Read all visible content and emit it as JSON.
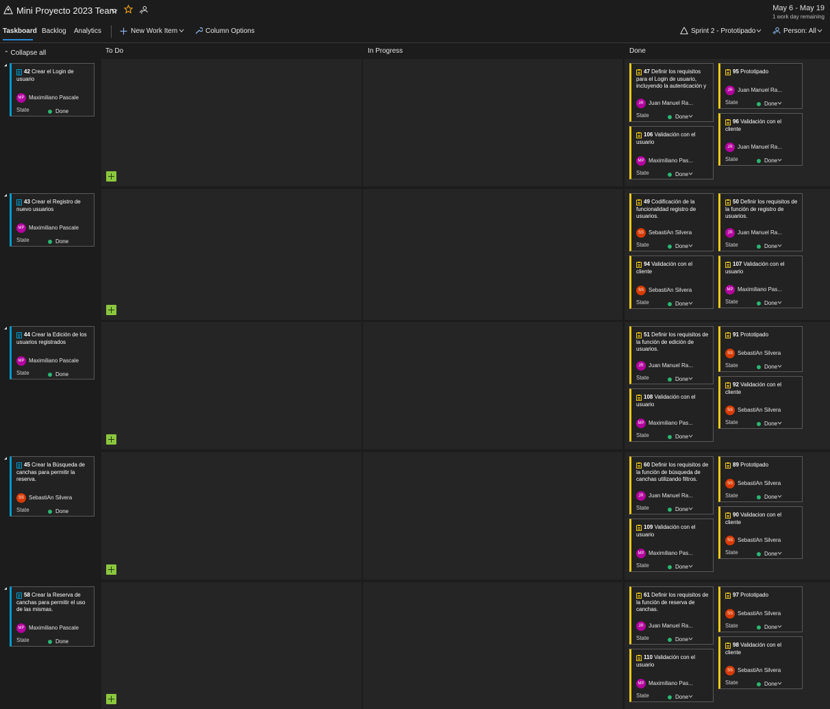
{
  "header": {
    "team_title": "Mini Proyecto 2023 Team",
    "date_range": "May 6 - May 19",
    "work_days": "1 work day remaining"
  },
  "nav": {
    "tabs": [
      {
        "label": "Taskboard",
        "active": true
      },
      {
        "label": "Backlog",
        "active": false
      },
      {
        "label": "Analytics",
        "active": false
      }
    ],
    "new_work_item": "New Work Item",
    "column_options": "Column Options",
    "sprint": "Sprint 2 - Prototipado",
    "person_filter": "Person: All"
  },
  "board": {
    "collapse_all": "Collapse all",
    "columns": [
      "To Do",
      "In Progress",
      "Done"
    ],
    "state_label": "State",
    "lanes": [
      {
        "story": {
          "id": "42",
          "title": "Crear el Login de usuario",
          "assignee": "Maximiliano Pascale",
          "initials": "MP",
          "state": "Done"
        },
        "tasks": [
          {
            "id": "47",
            "title": "Definir los requisitos para el Login de usuario, incluyendo la autenticación y",
            "assignee": "Juan Manuel Ra...",
            "initials": "JR",
            "state": "Done"
          },
          {
            "id": "95",
            "title": "Prototipado",
            "assignee": "Juan Manuel Ra...",
            "initials": "JR",
            "state": "Done"
          },
          {
            "id": "106",
            "title": "Validación con el usuario",
            "assignee": "Maximiliano Pas...",
            "initials": "MP",
            "state": "Done"
          },
          {
            "id": "96",
            "title": "Validación con el cliente",
            "assignee": "Juan Manuel Ra...",
            "initials": "JR",
            "state": "Done"
          }
        ]
      },
      {
        "story": {
          "id": "43",
          "title": "Crear el Registro de nuevo usuarios",
          "assignee": "Maximiliano Pascale",
          "initials": "MP",
          "state": "Done"
        },
        "tasks": [
          {
            "id": "49",
            "title": "Codificación de la funcionalidad registro de usuarios.",
            "assignee": "SebastiAn Silvera",
            "initials": "SS",
            "state": "Done"
          },
          {
            "id": "50",
            "title": "Definir los requisitos de la función de registro de usuarios.",
            "assignee": "Juan Manuel Ra...",
            "initials": "JR",
            "state": "Done"
          },
          {
            "id": "94",
            "title": "Validación con el cliente",
            "assignee": "SebastiAn Silvera",
            "initials": "SS",
            "state": "Done"
          },
          {
            "id": "107",
            "title": "Validación con el usuario",
            "assignee": "Maximiliano Pas...",
            "initials": "MP",
            "state": "Done"
          }
        ]
      },
      {
        "story": {
          "id": "44",
          "title": "Crear la Edición de los usuarios registrados",
          "assignee": "Maximiliano Pascale",
          "initials": "MP",
          "state": "Done"
        },
        "tasks": [
          {
            "id": "51",
            "title": "Definir los requisitos de la función de edición de usuarios.",
            "assignee": "Juan Manuel Ra...",
            "initials": "JR",
            "state": "Done"
          },
          {
            "id": "91",
            "title": "Prototipado",
            "assignee": "SebastiAn Silvera",
            "initials": "SS",
            "state": "Done"
          },
          {
            "id": "108",
            "title": "Validación con el usuario",
            "assignee": "Maximiliano Pas...",
            "initials": "MP",
            "state": "Done"
          },
          {
            "id": "92",
            "title": "Validación con el cliente",
            "assignee": "SebastiAn Silvera",
            "initials": "SS",
            "state": "Done"
          }
        ]
      },
      {
        "story": {
          "id": "45",
          "title": "Crear la Búsqueda de canchas para permitir la reserva.",
          "assignee": "SebastiAn Silvera",
          "initials": "SS",
          "state": "Done"
        },
        "tasks": [
          {
            "id": "60",
            "title": "Definir los requisitos de la función de búsqueda de canchas utilizando filtros.",
            "assignee": "Juan Manuel Ra...",
            "initials": "JR",
            "state": "Done"
          },
          {
            "id": "89",
            "title": "Prototipado",
            "assignee": "SebastiAn Silvera",
            "initials": "SS",
            "state": "Done"
          },
          {
            "id": "109",
            "title": "Validación con el usuario",
            "assignee": "Maximiliano Pas...",
            "initials": "MP",
            "state": "Done"
          },
          {
            "id": "90",
            "title": "Validacion con el cliente",
            "assignee": "SebastiAn Silvera",
            "initials": "SS",
            "state": "Done"
          }
        ]
      },
      {
        "story": {
          "id": "58",
          "title": "Crear la Reserva de canchas para permitir el uso de las mismas.",
          "assignee": "Maximiliano Pascale",
          "initials": "MP",
          "state": "Done"
        },
        "tasks": [
          {
            "id": "61",
            "title": "Definir los requisitos de la función de reserva de canchas.",
            "assignee": "Juan Manuel Ra...",
            "initials": "JR",
            "state": "Done"
          },
          {
            "id": "97",
            "title": "Prototipado",
            "assignee": "SebastiAn Silvera",
            "initials": "SS",
            "state": "Done"
          },
          {
            "id": "110",
            "title": "Validación con el usuario",
            "assignee": "Maximiliano Pas...",
            "initials": "MP",
            "state": "Done"
          },
          {
            "id": "98",
            "title": "Validación con el cliente",
            "assignee": "SebastiAn Silvera",
            "initials": "SS",
            "state": "Done"
          }
        ]
      }
    ]
  },
  "colors": {
    "story_accent": "#009ccc",
    "task_accent": "#f2cb1d",
    "done_dot": "#2bb673",
    "add_button": "#8cc63f",
    "avatar_mp": "#b4009e",
    "avatar_jr": "#b4009e",
    "avatar_ss": "#d83b01"
  }
}
